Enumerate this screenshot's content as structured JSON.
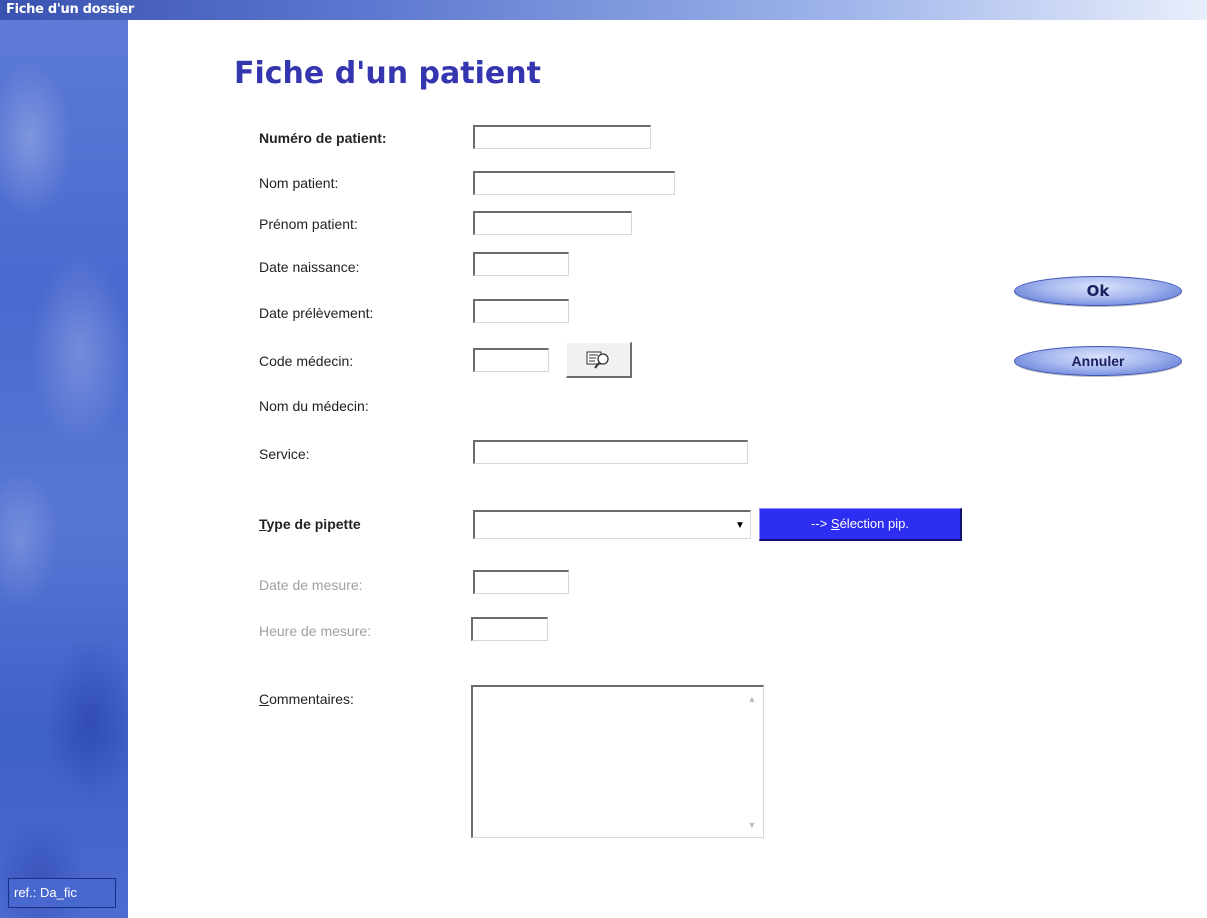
{
  "window": {
    "title": "Fiche d'un dossier",
    "ref": "ref.: Da_fic"
  },
  "page": {
    "title": "Fiche d'un patient"
  },
  "form": {
    "numero_patient": {
      "label": "Numéro de patient:",
      "value": ""
    },
    "nom_patient": {
      "label": "Nom patient:",
      "value": ""
    },
    "prenom_patient": {
      "label": "Prénom patient:",
      "value": ""
    },
    "date_naissance": {
      "label": "Date naissance:",
      "value": ""
    },
    "date_prelevement": {
      "label": "Date prélèvement:",
      "value": ""
    },
    "code_medecin": {
      "label": "Code médecin:",
      "value": ""
    },
    "nom_medecin": {
      "label": "Nom du médecin:"
    },
    "service": {
      "label": "Service:",
      "value": ""
    },
    "type_pipette": {
      "label_mnemonic": "T",
      "label_rest": "ype de pipette",
      "value": ""
    },
    "date_mesure": {
      "label": "Date de mesure:",
      "value": ""
    },
    "heure_mesure": {
      "label": "Heure de mesure:",
      "value": ""
    },
    "commentaires": {
      "label_mnemonic": "C",
      "label_rest": "ommentaires:",
      "value": ""
    }
  },
  "buttons": {
    "selection_prefix": "--> ",
    "selection_mnemonic": "S",
    "selection_rest": "élection pip.",
    "ok": "Ok",
    "annuler": "Annuler"
  },
  "icons": {
    "lookup": "doctor-search-icon",
    "combo_arrow": "chevron-down-icon",
    "scroll_up": "scroll-up-icon",
    "scroll_down": "scroll-down-icon"
  },
  "colors": {
    "title": "#3535b0",
    "sidebar": "#4a69cf",
    "selection_button": "#2e2ef2"
  }
}
